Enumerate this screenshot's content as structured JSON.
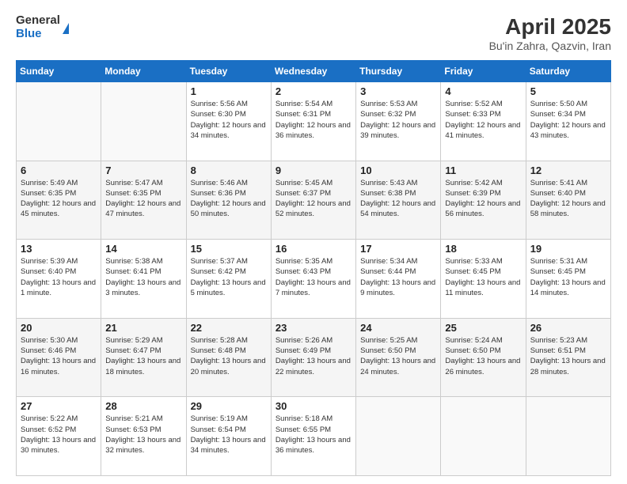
{
  "logo": {
    "general": "General",
    "blue": "Blue"
  },
  "header": {
    "title": "April 2025",
    "subtitle": "Bu'in Zahra, Qazvin, Iran"
  },
  "weekdays": [
    "Sunday",
    "Monday",
    "Tuesday",
    "Wednesday",
    "Thursday",
    "Friday",
    "Saturday"
  ],
  "weeks": [
    [
      {
        "day": "",
        "info": ""
      },
      {
        "day": "",
        "info": ""
      },
      {
        "day": "1",
        "info": "Sunrise: 5:56 AM\nSunset: 6:30 PM\nDaylight: 12 hours and 34 minutes."
      },
      {
        "day": "2",
        "info": "Sunrise: 5:54 AM\nSunset: 6:31 PM\nDaylight: 12 hours and 36 minutes."
      },
      {
        "day": "3",
        "info": "Sunrise: 5:53 AM\nSunset: 6:32 PM\nDaylight: 12 hours and 39 minutes."
      },
      {
        "day": "4",
        "info": "Sunrise: 5:52 AM\nSunset: 6:33 PM\nDaylight: 12 hours and 41 minutes."
      },
      {
        "day": "5",
        "info": "Sunrise: 5:50 AM\nSunset: 6:34 PM\nDaylight: 12 hours and 43 minutes."
      }
    ],
    [
      {
        "day": "6",
        "info": "Sunrise: 5:49 AM\nSunset: 6:35 PM\nDaylight: 12 hours and 45 minutes."
      },
      {
        "day": "7",
        "info": "Sunrise: 5:47 AM\nSunset: 6:35 PM\nDaylight: 12 hours and 47 minutes."
      },
      {
        "day": "8",
        "info": "Sunrise: 5:46 AM\nSunset: 6:36 PM\nDaylight: 12 hours and 50 minutes."
      },
      {
        "day": "9",
        "info": "Sunrise: 5:45 AM\nSunset: 6:37 PM\nDaylight: 12 hours and 52 minutes."
      },
      {
        "day": "10",
        "info": "Sunrise: 5:43 AM\nSunset: 6:38 PM\nDaylight: 12 hours and 54 minutes."
      },
      {
        "day": "11",
        "info": "Sunrise: 5:42 AM\nSunset: 6:39 PM\nDaylight: 12 hours and 56 minutes."
      },
      {
        "day": "12",
        "info": "Sunrise: 5:41 AM\nSunset: 6:40 PM\nDaylight: 12 hours and 58 minutes."
      }
    ],
    [
      {
        "day": "13",
        "info": "Sunrise: 5:39 AM\nSunset: 6:40 PM\nDaylight: 13 hours and 1 minute."
      },
      {
        "day": "14",
        "info": "Sunrise: 5:38 AM\nSunset: 6:41 PM\nDaylight: 13 hours and 3 minutes."
      },
      {
        "day": "15",
        "info": "Sunrise: 5:37 AM\nSunset: 6:42 PM\nDaylight: 13 hours and 5 minutes."
      },
      {
        "day": "16",
        "info": "Sunrise: 5:35 AM\nSunset: 6:43 PM\nDaylight: 13 hours and 7 minutes."
      },
      {
        "day": "17",
        "info": "Sunrise: 5:34 AM\nSunset: 6:44 PM\nDaylight: 13 hours and 9 minutes."
      },
      {
        "day": "18",
        "info": "Sunrise: 5:33 AM\nSunset: 6:45 PM\nDaylight: 13 hours and 11 minutes."
      },
      {
        "day": "19",
        "info": "Sunrise: 5:31 AM\nSunset: 6:45 PM\nDaylight: 13 hours and 14 minutes."
      }
    ],
    [
      {
        "day": "20",
        "info": "Sunrise: 5:30 AM\nSunset: 6:46 PM\nDaylight: 13 hours and 16 minutes."
      },
      {
        "day": "21",
        "info": "Sunrise: 5:29 AM\nSunset: 6:47 PM\nDaylight: 13 hours and 18 minutes."
      },
      {
        "day": "22",
        "info": "Sunrise: 5:28 AM\nSunset: 6:48 PM\nDaylight: 13 hours and 20 minutes."
      },
      {
        "day": "23",
        "info": "Sunrise: 5:26 AM\nSunset: 6:49 PM\nDaylight: 13 hours and 22 minutes."
      },
      {
        "day": "24",
        "info": "Sunrise: 5:25 AM\nSunset: 6:50 PM\nDaylight: 13 hours and 24 minutes."
      },
      {
        "day": "25",
        "info": "Sunrise: 5:24 AM\nSunset: 6:50 PM\nDaylight: 13 hours and 26 minutes."
      },
      {
        "day": "26",
        "info": "Sunrise: 5:23 AM\nSunset: 6:51 PM\nDaylight: 13 hours and 28 minutes."
      }
    ],
    [
      {
        "day": "27",
        "info": "Sunrise: 5:22 AM\nSunset: 6:52 PM\nDaylight: 13 hours and 30 minutes."
      },
      {
        "day": "28",
        "info": "Sunrise: 5:21 AM\nSunset: 6:53 PM\nDaylight: 13 hours and 32 minutes."
      },
      {
        "day": "29",
        "info": "Sunrise: 5:19 AM\nSunset: 6:54 PM\nDaylight: 13 hours and 34 minutes."
      },
      {
        "day": "30",
        "info": "Sunrise: 5:18 AM\nSunset: 6:55 PM\nDaylight: 13 hours and 36 minutes."
      },
      {
        "day": "",
        "info": ""
      },
      {
        "day": "",
        "info": ""
      },
      {
        "day": "",
        "info": ""
      }
    ]
  ]
}
